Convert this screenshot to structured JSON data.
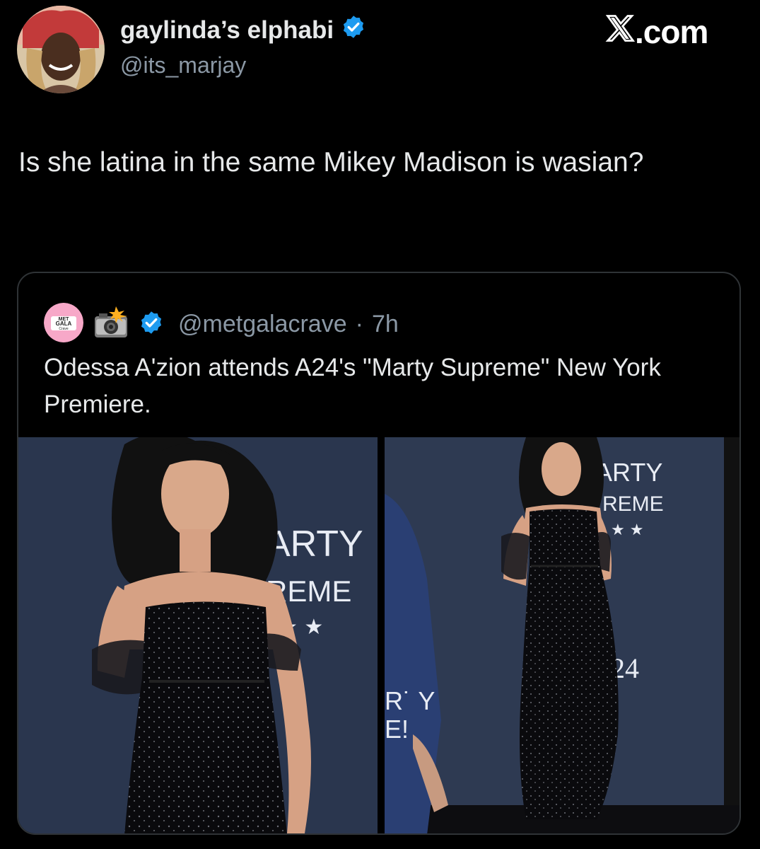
{
  "author": {
    "display_name": "gaylinda’s elphabi",
    "handle": "@its_marjay",
    "verified": true
  },
  "brand": {
    "label": ".com",
    "icon": "x-logo-icon"
  },
  "tweet": {
    "text": "Is she latina in the same Mikey Madison is wasian?"
  },
  "quote": {
    "avatar_text": [
      "MET",
      "GALA",
      "Crave"
    ],
    "emoji_icon": "camera-flash-icon",
    "verified": true,
    "handle": "@metgalacrave",
    "separator": "·",
    "time": "7h",
    "text": "Odessa A'zion attends A24's \"Marty Supreme\" New York Premiere.",
    "photos": [
      {
        "backdrop_lines": [
          "ARTY",
          "REME",
          "★ ★"
        ]
      },
      {
        "backdrop_lines": [
          "ARTY",
          "REME",
          "★ ★",
          "24",
          "R˙ Y",
          "E!"
        ]
      }
    ]
  },
  "colors": {
    "background": "#000000",
    "text": "#e7e9ea",
    "muted": "#8b98a5",
    "verified": "#1d9bf0",
    "border": "#2f3336",
    "backdrop": "#2e3a52"
  }
}
